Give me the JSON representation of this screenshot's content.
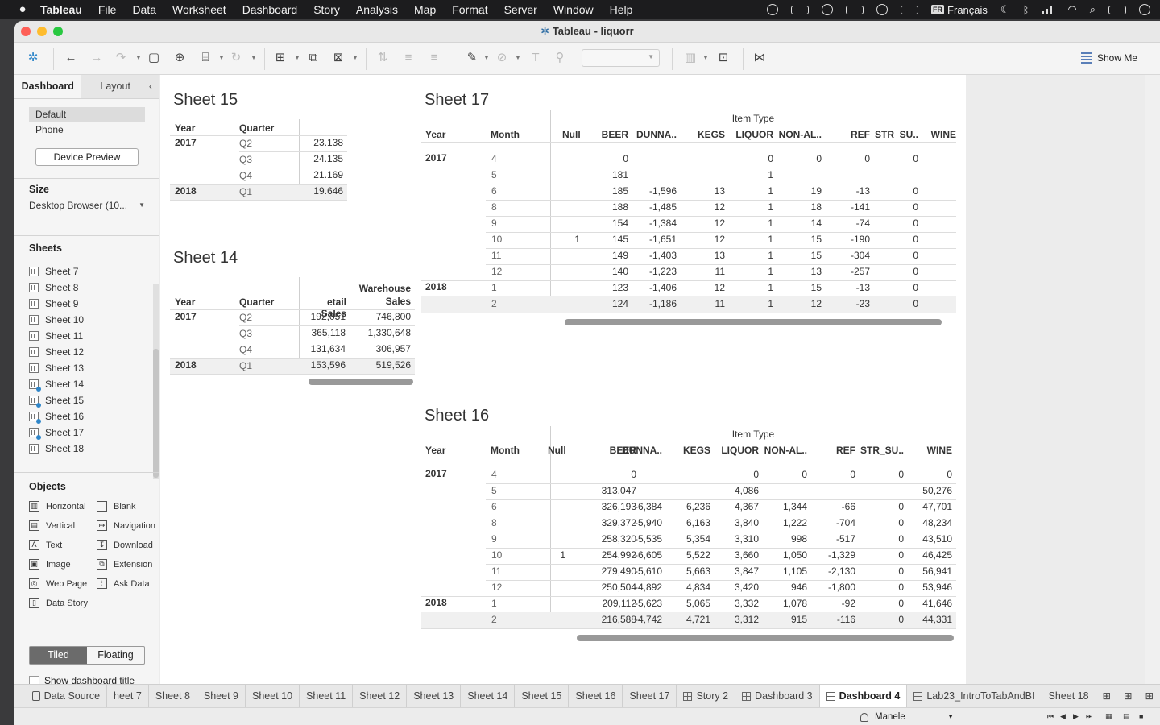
{
  "menubar": {
    "app": "Tableau",
    "items": [
      "File",
      "Data",
      "Worksheet",
      "Dashboard",
      "Story",
      "Analysis",
      "Map",
      "Format",
      "Server",
      "Window",
      "Help"
    ],
    "language": "Français",
    "lang_badge": "FR"
  },
  "window": {
    "title": "Tableau - liquorr"
  },
  "toolbar": {
    "show_me": "Show Me"
  },
  "sidebar": {
    "tabs": [
      "Dashboard",
      "Layout"
    ],
    "device_options": [
      "Default",
      "Phone"
    ],
    "device_preview": "Device Preview",
    "size_label": "Size",
    "size_value": "Desktop Browser (10...",
    "sheets_label": "Sheets",
    "sheets": [
      {
        "name": "Sheet 7",
        "used": false
      },
      {
        "name": "Sheet 8",
        "used": false
      },
      {
        "name": "Sheet 9",
        "used": false
      },
      {
        "name": "Sheet 10",
        "used": false
      },
      {
        "name": "Sheet 11",
        "used": false
      },
      {
        "name": "Sheet 12",
        "used": false
      },
      {
        "name": "Sheet 13",
        "used": false
      },
      {
        "name": "Sheet 14",
        "used": true
      },
      {
        "name": "Sheet 15",
        "used": true
      },
      {
        "name": "Sheet 16",
        "used": true
      },
      {
        "name": "Sheet 17",
        "used": true
      },
      {
        "name": "Sheet 18",
        "used": false
      }
    ],
    "objects_label": "Objects",
    "objects": [
      {
        "name": "Horizontal",
        "icon": "horizontal-icon",
        "glyph": "▥"
      },
      {
        "name": "Blank",
        "icon": "blank-icon",
        "glyph": ""
      },
      {
        "name": "Vertical",
        "icon": "vertical-icon",
        "glyph": "▤"
      },
      {
        "name": "Navigation",
        "icon": "navigation-icon",
        "glyph": "↦"
      },
      {
        "name": "Text",
        "icon": "text-icon",
        "glyph": "A"
      },
      {
        "name": "Download",
        "icon": "download-icon",
        "glyph": "↧"
      },
      {
        "name": "Image",
        "icon": "image-icon",
        "glyph": "▣"
      },
      {
        "name": "Extension",
        "icon": "extension-icon",
        "glyph": "⧉"
      },
      {
        "name": "Web Page",
        "icon": "web-page-icon",
        "glyph": "◎"
      },
      {
        "name": "Ask Data",
        "icon": "ask-data-icon",
        "glyph": "⫶"
      },
      {
        "name": "Data Story",
        "icon": "data-story-icon",
        "glyph": "▯"
      }
    ],
    "layout_modes": [
      "Tiled",
      "Floating"
    ],
    "show_title": "Show dashboard title"
  },
  "sheet15": {
    "title": "Sheet 15",
    "col_year": "Year",
    "col_quarter": "Quarter",
    "rows": [
      {
        "year": "2017",
        "quarter": "Q2",
        "value": "23.138"
      },
      {
        "year": "",
        "quarter": "Q3",
        "value": "24.135"
      },
      {
        "year": "",
        "quarter": "Q4",
        "value": "21.169"
      },
      {
        "year": "2018",
        "quarter": "Q1",
        "value": "19.646"
      }
    ]
  },
  "sheet14": {
    "title": "Sheet 14",
    "col_year": "Year",
    "col_quarter": "Quarter",
    "col_retail": "etail Sales",
    "col_warehouse_1": "Warehouse",
    "col_warehouse_2": "Sales",
    "rows": [
      {
        "year": "2017",
        "quarter": "Q2",
        "retail": "192,051",
        "warehouse": "746,800"
      },
      {
        "year": "",
        "quarter": "Q3",
        "retail": "365,118",
        "warehouse": "1,330,648"
      },
      {
        "year": "",
        "quarter": "Q4",
        "retail": "131,634",
        "warehouse": "306,957"
      },
      {
        "year": "2018",
        "quarter": "Q1",
        "retail": "153,596",
        "warehouse": "519,526"
      }
    ]
  },
  "sheet17": {
    "title": "Sheet 17",
    "group_header": "Item Type",
    "col_year": "Year",
    "col_month": "Month",
    "columns": [
      "Null",
      "BEER",
      "DUNNA..",
      "KEGS",
      "LIQUOR",
      "NON-AL..",
      "REF",
      "STR_SU..",
      "WINE"
    ],
    "rows": [
      {
        "year": "2017",
        "month": "4",
        "cells": [
          "",
          "0",
          "",
          "",
          "0",
          "0",
          "0",
          "0",
          ""
        ]
      },
      {
        "year": "",
        "month": "5",
        "cells": [
          "",
          "181",
          "",
          "",
          "1",
          "",
          "",
          "",
          ""
        ]
      },
      {
        "year": "",
        "month": "6",
        "cells": [
          "",
          "185",
          "-1,596",
          "13",
          "1",
          "19",
          "-13",
          "0",
          ""
        ]
      },
      {
        "year": "",
        "month": "8",
        "cells": [
          "",
          "188",
          "-1,485",
          "12",
          "1",
          "18",
          "-141",
          "0",
          ""
        ]
      },
      {
        "year": "",
        "month": "9",
        "cells": [
          "",
          "154",
          "-1,384",
          "12",
          "1",
          "14",
          "-74",
          "0",
          ""
        ]
      },
      {
        "year": "",
        "month": "10",
        "cells": [
          "1",
          "145",
          "-1,651",
          "12",
          "1",
          "15",
          "-190",
          "0",
          ""
        ]
      },
      {
        "year": "",
        "month": "11",
        "cells": [
          "",
          "149",
          "-1,403",
          "13",
          "1",
          "15",
          "-304",
          "0",
          ""
        ]
      },
      {
        "year": "",
        "month": "12",
        "cells": [
          "",
          "140",
          "-1,223",
          "11",
          "1",
          "13",
          "-257",
          "0",
          ""
        ]
      },
      {
        "year": "2018",
        "month": "1",
        "cells": [
          "",
          "123",
          "-1,406",
          "12",
          "1",
          "15",
          "-13",
          "0",
          ""
        ]
      },
      {
        "year": "",
        "month": "2",
        "cells": [
          "",
          "124",
          "-1,186",
          "11",
          "1",
          "12",
          "-23",
          "0",
          ""
        ]
      }
    ]
  },
  "sheet16": {
    "title": "Sheet 16",
    "group_header": "Item Type",
    "col_year": "Year",
    "col_month": "Month",
    "columns": [
      "Null",
      "BEER",
      "DUNNA..",
      "KEGS",
      "LIQUOR",
      "NON-AL..",
      "REF",
      "STR_SU..",
      "WINE"
    ],
    "rows": [
      {
        "year": "2017",
        "month": "4",
        "cells": [
          "",
          "0",
          "",
          "",
          "0",
          "0",
          "0",
          "0",
          "0"
        ]
      },
      {
        "year": "",
        "month": "5",
        "cells": [
          "",
          "313,047",
          "",
          "",
          "4,086",
          "",
          "",
          "",
          "50,276"
        ]
      },
      {
        "year": "",
        "month": "6",
        "cells": [
          "",
          "326,193",
          "-6,384",
          "6,236",
          "4,367",
          "1,344",
          "-66",
          "0",
          "47,701"
        ]
      },
      {
        "year": "",
        "month": "8",
        "cells": [
          "",
          "329,372",
          "-5,940",
          "6,163",
          "3,840",
          "1,222",
          "-704",
          "0",
          "48,234"
        ]
      },
      {
        "year": "",
        "month": "9",
        "cells": [
          "",
          "258,320",
          "-5,535",
          "5,354",
          "3,310",
          "998",
          "-517",
          "0",
          "43,510"
        ]
      },
      {
        "year": "",
        "month": "10",
        "cells": [
          "1",
          "254,992",
          "-6,605",
          "5,522",
          "3,660",
          "1,050",
          "-1,329",
          "0",
          "46,425"
        ]
      },
      {
        "year": "",
        "month": "11",
        "cells": [
          "",
          "279,490",
          "-5,610",
          "5,663",
          "3,847",
          "1,105",
          "-2,130",
          "0",
          "56,941"
        ]
      },
      {
        "year": "",
        "month": "12",
        "cells": [
          "",
          "250,504",
          "-4,892",
          "4,834",
          "3,420",
          "946",
          "-1,800",
          "0",
          "53,946"
        ]
      },
      {
        "year": "2018",
        "month": "1",
        "cells": [
          "",
          "209,112",
          "-5,623",
          "5,065",
          "3,332",
          "1,078",
          "-92",
          "0",
          "41,646"
        ]
      },
      {
        "year": "",
        "month": "2",
        "cells": [
          "",
          "216,588",
          "-4,742",
          "4,721",
          "3,312",
          "915",
          "-116",
          "0",
          "44,331"
        ]
      }
    ]
  },
  "bottom_tabs": [
    {
      "label": "Data Source",
      "type": "datasource",
      "active": false
    },
    {
      "label": "heet 7",
      "type": "sheet",
      "active": false
    },
    {
      "label": "Sheet 8",
      "type": "sheet",
      "active": false
    },
    {
      "label": "Sheet 9",
      "type": "sheet",
      "active": false
    },
    {
      "label": "Sheet 10",
      "type": "sheet",
      "active": false
    },
    {
      "label": "Sheet 11",
      "type": "sheet",
      "active": false
    },
    {
      "label": "Sheet 12",
      "type": "sheet",
      "active": false
    },
    {
      "label": "Sheet 13",
      "type": "sheet",
      "active": false
    },
    {
      "label": "Sheet 14",
      "type": "sheet",
      "active": false
    },
    {
      "label": "Sheet 15",
      "type": "sheet",
      "active": false
    },
    {
      "label": "Sheet 16",
      "type": "sheet",
      "active": false
    },
    {
      "label": "Sheet 17",
      "type": "sheet",
      "active": false
    },
    {
      "label": "Story 2",
      "type": "story",
      "active": false
    },
    {
      "label": "Dashboard 3",
      "type": "dashboard",
      "active": false
    },
    {
      "label": "Dashboard 4",
      "type": "dashboard",
      "active": true
    },
    {
      "label": "Lab23_IntroToTabAndBI",
      "type": "story",
      "active": false
    },
    {
      "label": "Sheet 18",
      "type": "sheet",
      "active": false
    }
  ],
  "status": {
    "user": "Manele"
  },
  "colors": {
    "accent": "#2f86c9",
    "menubar": "#1c1c1e",
    "close": "#fe5f57",
    "minimize": "#febc2e",
    "zoom": "#28c840"
  }
}
